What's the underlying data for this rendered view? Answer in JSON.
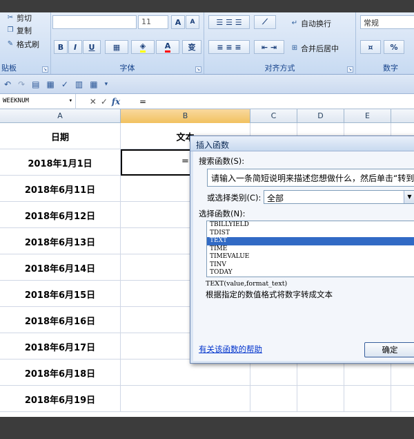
{
  "ribbon": {
    "clipboard": {
      "cut": "剪切",
      "copy": "复制",
      "painter": "格式刷",
      "label": "贴板"
    },
    "font": {
      "size": "11",
      "grow": "A",
      "shrink": "A",
      "bold": "B",
      "italic": "I",
      "underline": "U",
      "phonetic": "变",
      "label": "字体"
    },
    "align": {
      "wrap": "自动换行",
      "merge": "合并后居中",
      "label": "对齐方式"
    },
    "number": {
      "format": "常规",
      "percent": "%",
      "label": "数字"
    }
  },
  "namebox": {
    "value": "WEEKNUM"
  },
  "formula": {
    "fx": "fx",
    "content": "="
  },
  "columns": [
    "A",
    "B",
    "C",
    "D",
    "E"
  ],
  "table": {
    "header": {
      "a": "日期",
      "b": "文本"
    },
    "b2": "=",
    "dates": [
      "2018年1月1日",
      "2018年6月11日",
      "2018年6月12日",
      "2018年6月13日",
      "2018年6月14日",
      "2018年6月15日",
      "2018年6月16日",
      "2018年6月17日",
      "2018年6月18日",
      "2018年6月19日"
    ]
  },
  "dialog": {
    "title": "插入函数",
    "search_label": "搜索函数(S):",
    "search_value": "请输入一条简短说明来描述您想做什么，然后单击“转到”",
    "category_label": "或选择类别(C):",
    "category_value": "全部",
    "function_label": "选择函数(N):",
    "functions": [
      "TBILLYIELD",
      "TDIST",
      "TEXT",
      "TIME",
      "TIMEVALUE",
      "TINV",
      "TODAY"
    ],
    "selected_index": 2,
    "signature": "TEXT(value,format_text)",
    "description": "根据指定的数值格式将数字转成文本",
    "help_link": "有关该函数的帮助",
    "ok": "确定"
  },
  "colors": {
    "selection": "#316ac5",
    "ribbon_label": "#15428b",
    "selected_header": "#f1c15f"
  }
}
